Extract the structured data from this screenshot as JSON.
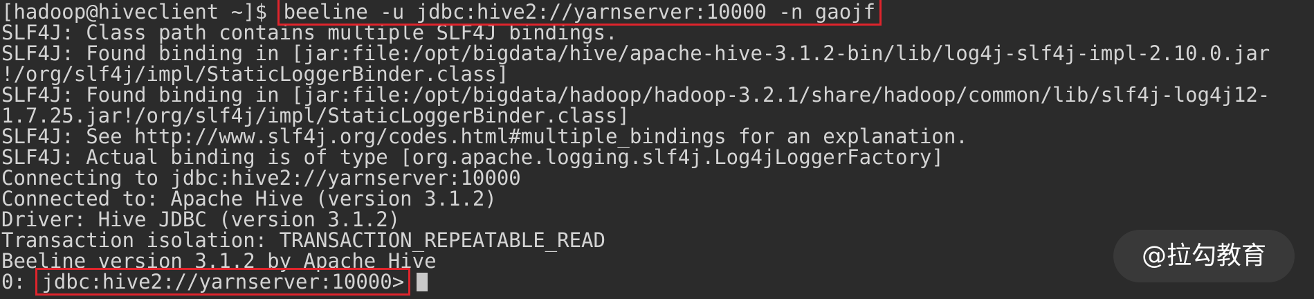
{
  "prompt": "[hadoop@hiveclient ~]$ ",
  "command": "beeline -u jdbc:hive2://yarnserver:10000 -n gaojf",
  "output_lines": [
    "SLF4J: Class path contains multiple SLF4J bindings.",
    "SLF4J: Found binding in [jar:file:/opt/bigdata/hive/apache-hive-3.1.2-bin/lib/log4j-slf4j-impl-2.10.0.jar",
    "!/org/slf4j/impl/StaticLoggerBinder.class]",
    "SLF4J: Found binding in [jar:file:/opt/bigdata/hadoop/hadoop-3.2.1/share/hadoop/common/lib/slf4j-log4j12-",
    "1.7.25.jar!/org/slf4j/impl/StaticLoggerBinder.class]",
    "SLF4J: See http://www.slf4j.org/codes.html#multiple_bindings for an explanation.",
    "SLF4J: Actual binding is of type [org.apache.logging.slf4j.Log4jLoggerFactory]",
    "Connecting to jdbc:hive2://yarnserver:10000",
    "Connected to: Apache Hive (version 3.1.2)",
    "Driver: Hive JDBC (version 3.1.2)",
    "Transaction isolation: TRANSACTION_REPEATABLE_READ",
    "Beeline version 3.1.2 by Apache Hive"
  ],
  "beeline_prompt_prefix": "0: ",
  "beeline_prompt": "jdbc:hive2://yarnserver:10000>",
  "watermark": "@拉勾教育",
  "colors": {
    "background": "#2b2b2b",
    "text": "#d4d4d4",
    "highlight_border": "#e0242c"
  }
}
